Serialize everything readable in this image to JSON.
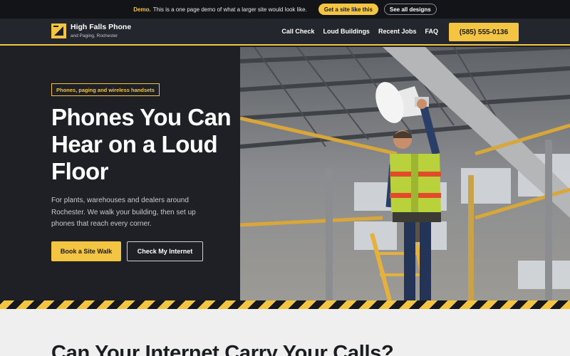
{
  "demo_bar": {
    "label": "Demo.",
    "text": "This is a one page demo of what a larger site would look like.",
    "cta_primary": "Get a site like this",
    "cta_secondary": "See all designs"
  },
  "brand": {
    "name": "High Falls Phone",
    "tagline": "and Paging, Rochester",
    "icon": "logo-icon",
    "accent_color": "#f4c542",
    "dark_color": "#1e2026"
  },
  "nav": {
    "items": [
      {
        "label": "Call Check"
      },
      {
        "label": "Loud Buildings"
      },
      {
        "label": "Recent Jobs"
      },
      {
        "label": "FAQ"
      }
    ],
    "phone": "(585) 555-0136"
  },
  "hero": {
    "tag": "Phones, paging and wireless handsets",
    "headline": "Phones You Can Hear on a Loud Floor",
    "lede": "For plants, warehouses and dealers around Rochester. We walk your building, then set up phones that reach every corner.",
    "primary_cta": "Book a Site Walk",
    "secondary_cta": "Check My Internet",
    "image_alt": "worker-installing-horn-speaker-photo"
  },
  "section2": {
    "title": "Can Your Internet Carry Your Calls?"
  }
}
